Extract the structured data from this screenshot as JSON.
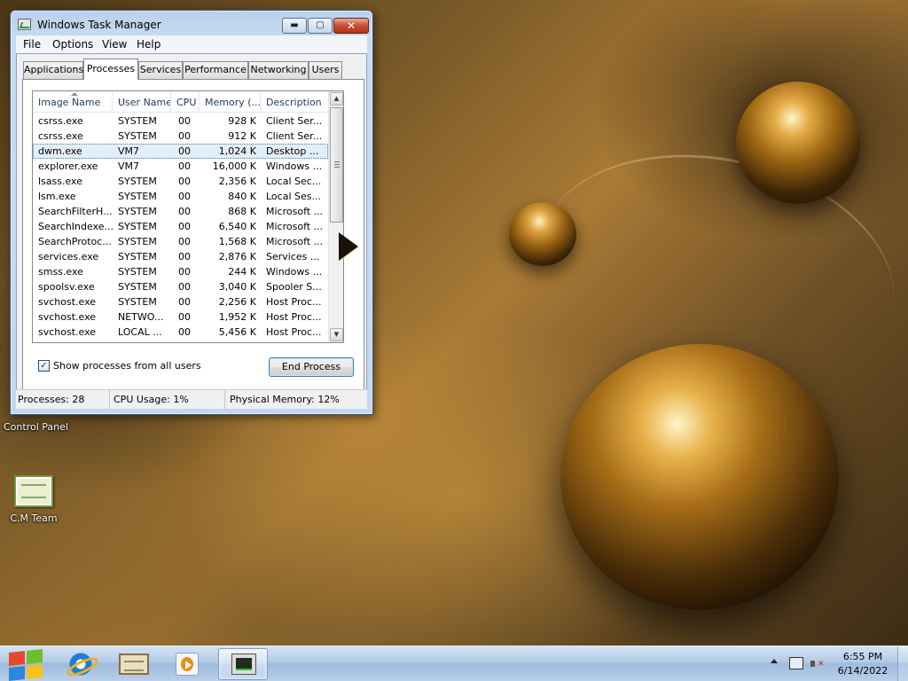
{
  "window": {
    "title": "Windows Task Manager",
    "min_glyph": "▬",
    "max_glyph": "▢",
    "close_glyph": "✕"
  },
  "menu": {
    "items": [
      "File",
      "Options",
      "View",
      "Help"
    ]
  },
  "tabs": [
    "Applications",
    "Processes",
    "Services",
    "Performance",
    "Networking",
    "Users"
  ],
  "active_tab": "Processes",
  "process_table": {
    "columns": [
      "Image Name",
      "User Name",
      "CPU",
      "Memory (...",
      "Description"
    ],
    "sorted_column": "Image Name",
    "selected_row": "dwm.exe",
    "rows": [
      {
        "name": "csrss.exe",
        "user": "SYSTEM",
        "cpu": "00",
        "memory": "928 K",
        "description": "Client Ser..."
      },
      {
        "name": "csrss.exe",
        "user": "SYSTEM",
        "cpu": "00",
        "memory": "912 K",
        "description": "Client Ser..."
      },
      {
        "name": "dwm.exe",
        "user": "VM7",
        "cpu": "00",
        "memory": "1,024 K",
        "description": "Desktop ..."
      },
      {
        "name": "explorer.exe",
        "user": "VM7",
        "cpu": "00",
        "memory": "16,000 K",
        "description": "Windows ..."
      },
      {
        "name": "lsass.exe",
        "user": "SYSTEM",
        "cpu": "00",
        "memory": "2,356 K",
        "description": "Local Sec..."
      },
      {
        "name": "lsm.exe",
        "user": "SYSTEM",
        "cpu": "00",
        "memory": "840 K",
        "description": "Local Ses..."
      },
      {
        "name": "SearchFilterH...",
        "user": "SYSTEM",
        "cpu": "00",
        "memory": "868 K",
        "description": "Microsoft ..."
      },
      {
        "name": "SearchIndexe...",
        "user": "SYSTEM",
        "cpu": "00",
        "memory": "6,540 K",
        "description": "Microsoft ..."
      },
      {
        "name": "SearchProtoc...",
        "user": "SYSTEM",
        "cpu": "00",
        "memory": "1,568 K",
        "description": "Microsoft ..."
      },
      {
        "name": "services.exe",
        "user": "SYSTEM",
        "cpu": "00",
        "memory": "2,876 K",
        "description": "Services ..."
      },
      {
        "name": "smss.exe",
        "user": "SYSTEM",
        "cpu": "00",
        "memory": "244 K",
        "description": "Windows ..."
      },
      {
        "name": "spoolsv.exe",
        "user": "SYSTEM",
        "cpu": "00",
        "memory": "3,040 K",
        "description": "Spooler S..."
      },
      {
        "name": "svchost.exe",
        "user": "SYSTEM",
        "cpu": "00",
        "memory": "2,256 K",
        "description": "Host Proc..."
      },
      {
        "name": "svchost.exe",
        "user": "NETWO...",
        "cpu": "00",
        "memory": "1,952 K",
        "description": "Host Proc..."
      },
      {
        "name": "svchost.exe",
        "user": "LOCAL ...",
        "cpu": "00",
        "memory": "5,456 K",
        "description": "Host Proc..."
      }
    ]
  },
  "scroll": {
    "up_glyph": "▲",
    "down_glyph": "▼"
  },
  "show_all_processes": {
    "label": "Show processes from all users",
    "checked": true,
    "check_glyph": "✓"
  },
  "end_process_label": "End Process",
  "status": {
    "processes": "Processes: 28",
    "cpu_usage": "CPU Usage: 1%",
    "physical_memory": "Physical Memory: 12%"
  },
  "desktop": {
    "control_panel_label": "Control Panel",
    "cm_team_label": "C.M Team"
  },
  "taskbar": {
    "time": "6:55 PM",
    "date": "6/14/2022"
  }
}
